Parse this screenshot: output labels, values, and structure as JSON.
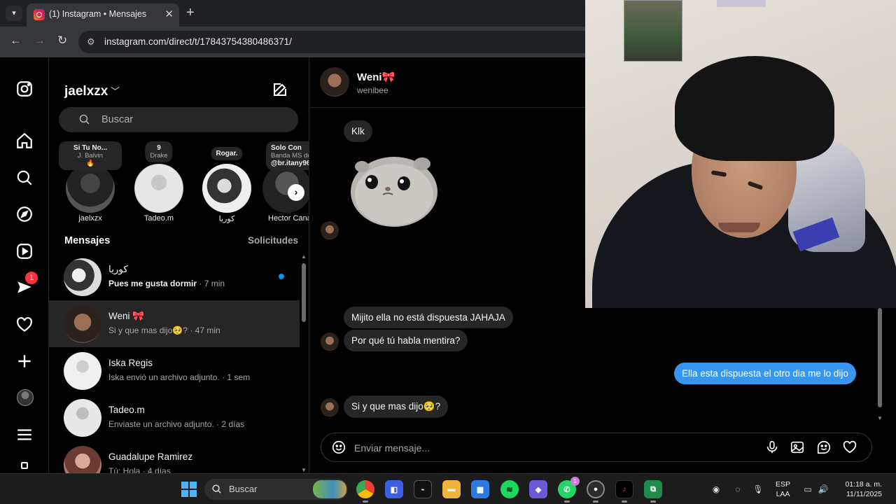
{
  "browser": {
    "tab_title": "(1) Instagram • Mensajes",
    "url": "instagram.com/direct/t/17843754380486371/"
  },
  "rail": {
    "notification_count": "1"
  },
  "inbox": {
    "username": "jaelxzx",
    "search_placeholder": "Buscar",
    "notes": [
      {
        "title": "Si Tu No...",
        "subtitle": "J. Balvin",
        "extra": "🔥",
        "name": "jaelxzx"
      },
      {
        "title": "9",
        "subtitle": "Drake",
        "extra": "",
        "name": "Tadeo.m"
      },
      {
        "title": "Rogar.",
        "subtitle": "",
        "extra": "",
        "name": "كوريا"
      },
      {
        "title": "Solo Con",
        "subtitle": "Banda MS de",
        "extra": "@br.itany96",
        "name": "Hector Cana"
      }
    ],
    "section_title": "Mensajes",
    "requests_label": "Solicitudes",
    "conversations": [
      {
        "name": "كوريا",
        "preview": "Pues me gusta dormir",
        "time": " · 7 min"
      },
      {
        "name": "Weni 🎀",
        "preview": "Si y que mas dijo🥺?",
        "time": " · 47 min"
      },
      {
        "name": "Iska Regis",
        "preview": "Iska envió un archivo adjunto.",
        "time": " · 1 sem"
      },
      {
        "name": "Tadeo.m",
        "preview": "Enviaste un archivo adjunto.",
        "time": " · 2 días"
      },
      {
        "name": "Guadalupe Ramirez",
        "preview": "Tú: Hola",
        "time": " · 4 días"
      }
    ]
  },
  "chat": {
    "name": "Weni🎀",
    "handle": "wenibee",
    "messages": [
      {
        "text": "Klk"
      },
      {
        "text": "Mijito ella no está dispuesta JAHAJA"
      },
      {
        "text": "Por qué tú habla mentira?"
      },
      {
        "text": "Ella esta dispuesta el otro dia me lo dijo"
      },
      {
        "text": "Si y que mas dijo🥺?"
      }
    ],
    "composer_placeholder": "Enviar mensaje..."
  },
  "taskbar": {
    "search_label": "Buscar",
    "lang_1": "ESP",
    "lang_2": "LAA",
    "time": "01:18 a. m.",
    "date": "11/11/2025",
    "whatsapp_badge": "1"
  }
}
